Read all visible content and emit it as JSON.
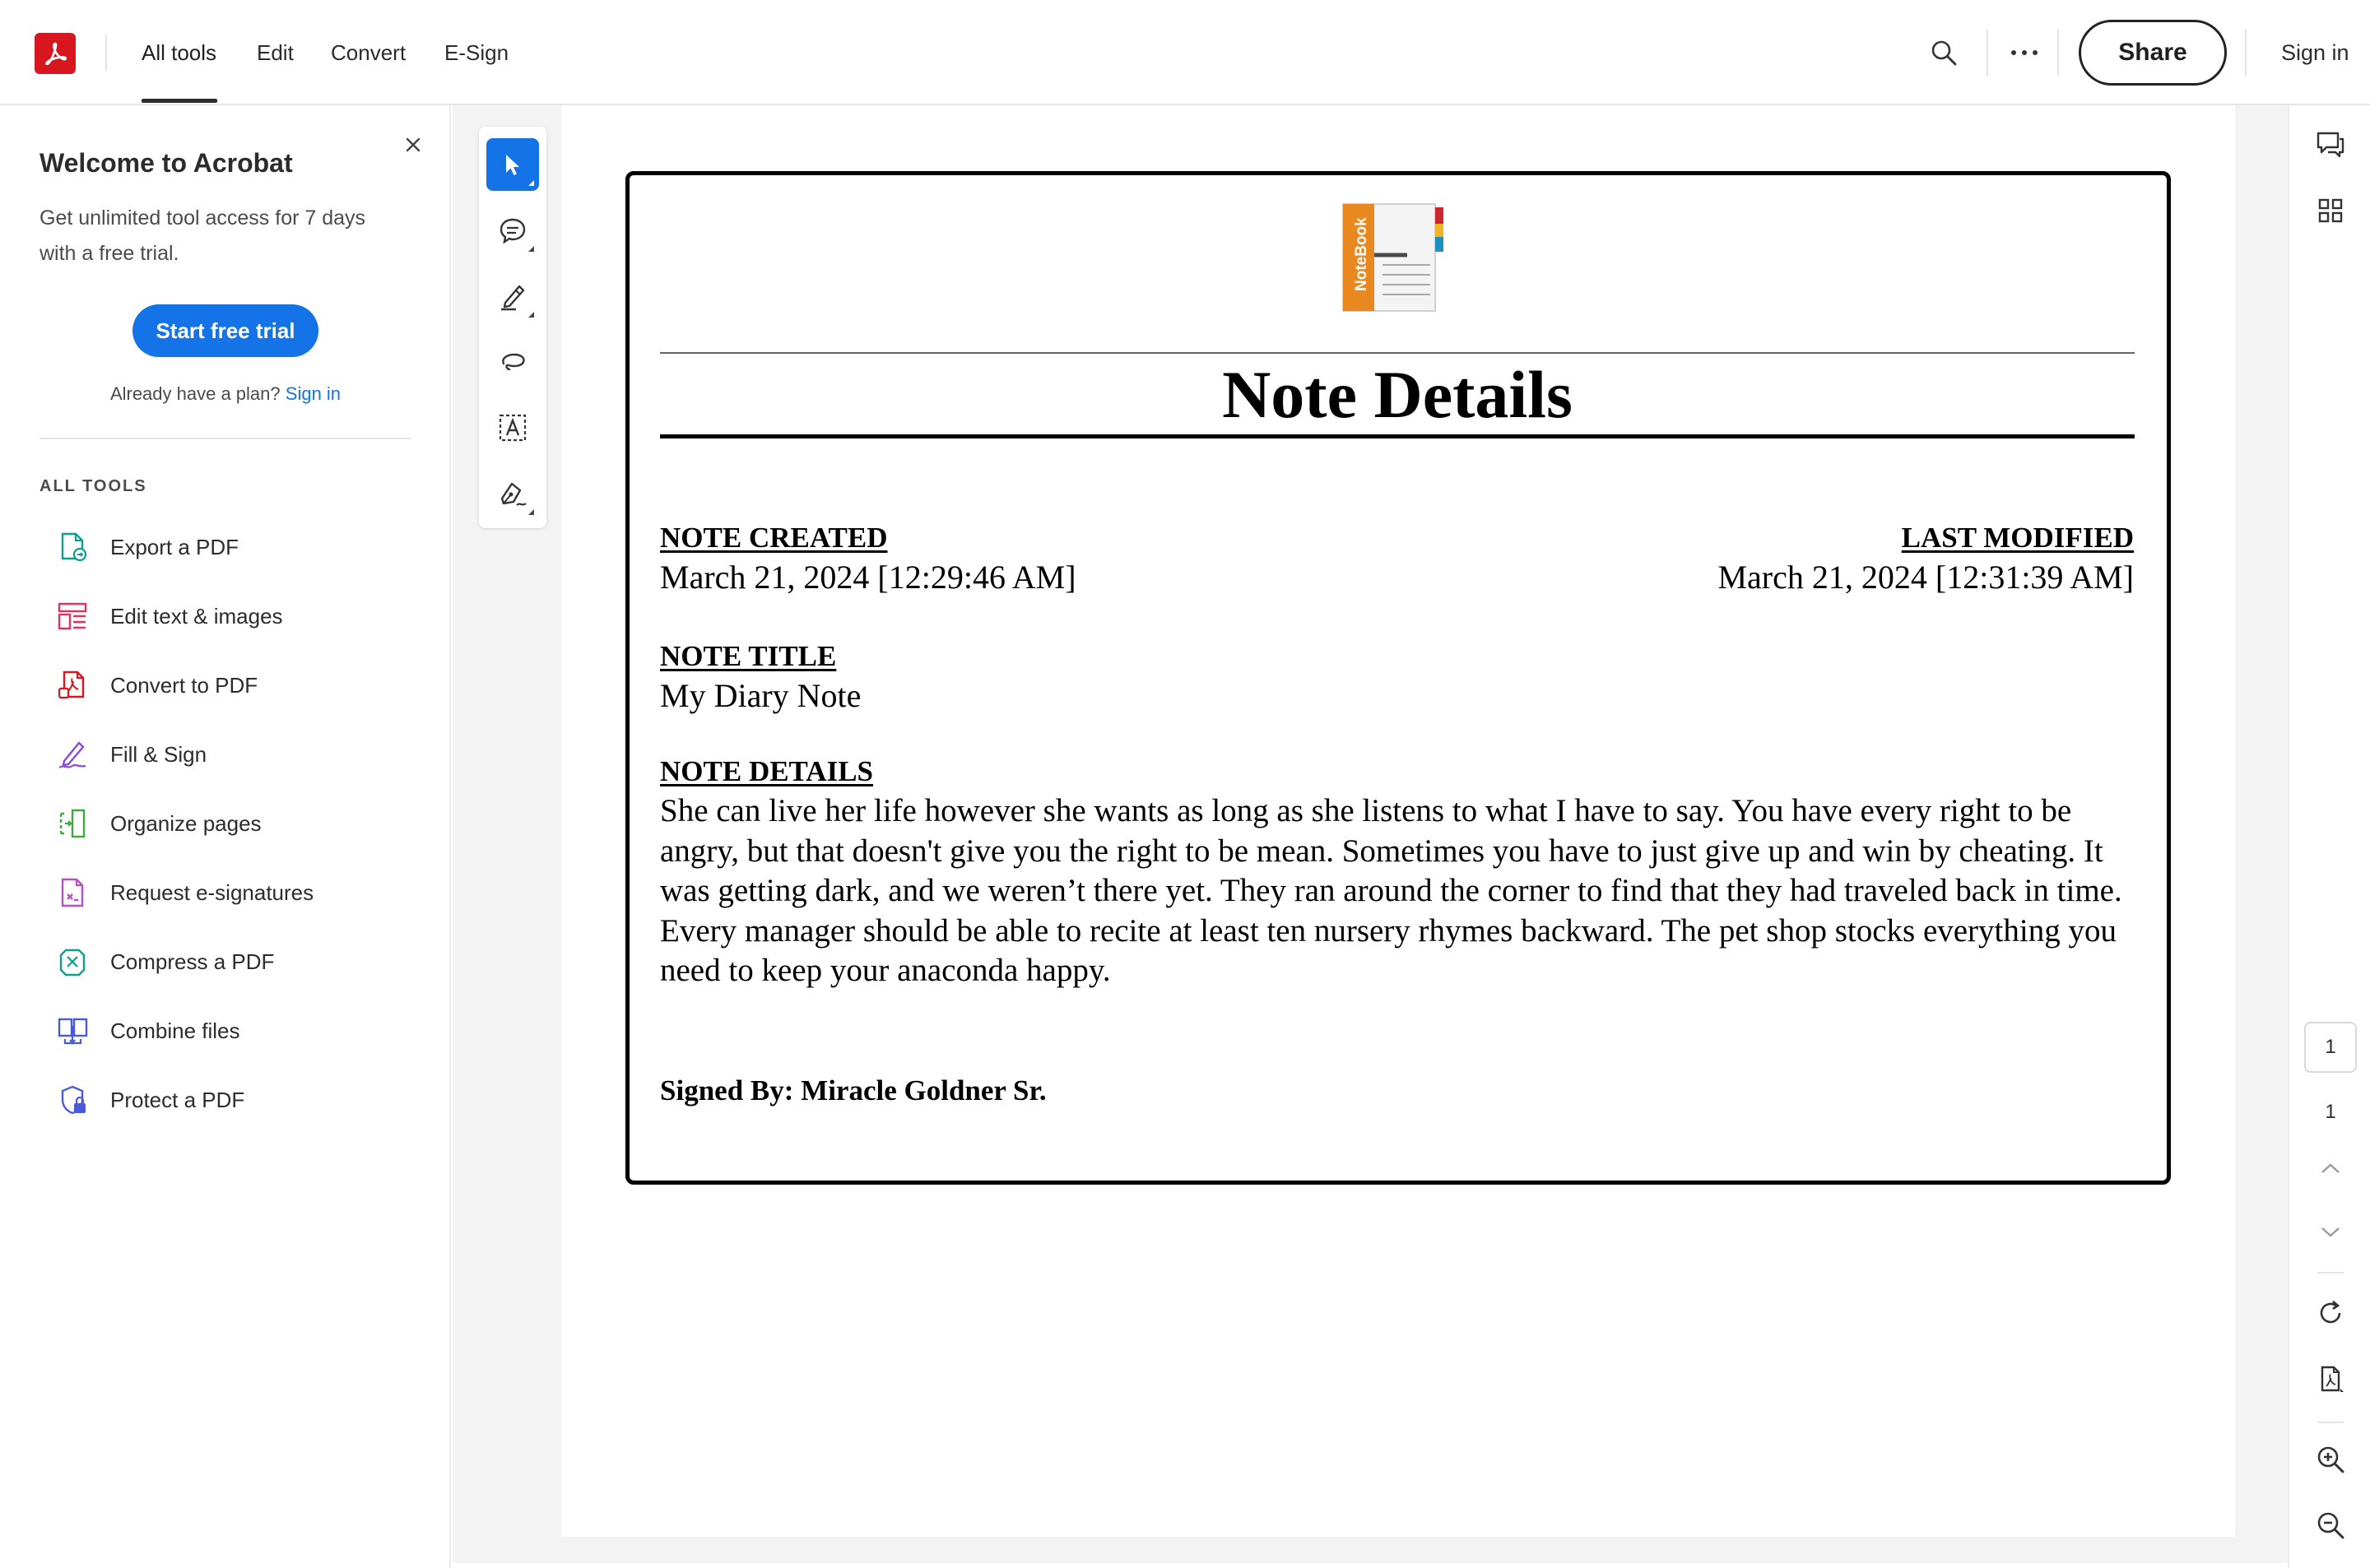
{
  "topbar": {
    "tabs": [
      {
        "label": "All tools",
        "active": true
      },
      {
        "label": "Edit",
        "active": false
      },
      {
        "label": "Convert",
        "active": false
      },
      {
        "label": "E-Sign",
        "active": false
      }
    ],
    "share_label": "Share",
    "signin_label": "Sign in",
    "icons": [
      "acrobat-logo-icon",
      "search-icon",
      "more-options-icon"
    ]
  },
  "left_panel": {
    "title": "Welcome to Acrobat",
    "text": "Get unlimited tool access for 7 days with a free trial.",
    "trial_button": "Start free trial",
    "plan_text": "Already have a plan?",
    "plan_link": "Sign in",
    "section_heading": "ALL TOOLS",
    "tools": [
      {
        "label": "Export a PDF",
        "icon": "export-pdf-icon",
        "color": "#0e9e8e"
      },
      {
        "label": "Edit text & images",
        "icon": "edit-text-icon",
        "color": "#e0345f"
      },
      {
        "label": "Convert to PDF",
        "icon": "convert-pdf-icon",
        "color": "#d7161f"
      },
      {
        "label": "Fill & Sign",
        "icon": "fill-sign-icon",
        "color": "#8a4bd6"
      },
      {
        "label": "Organize pages",
        "icon": "organize-pages-icon",
        "color": "#3fa83f"
      },
      {
        "label": "Request e-signatures",
        "icon": "request-esign-icon",
        "color": "#b64fc8"
      },
      {
        "label": "Compress a PDF",
        "icon": "compress-pdf-icon",
        "color": "#0e9e8e"
      },
      {
        "label": "Combine files",
        "icon": "combine-files-icon",
        "color": "#4a5ad8"
      },
      {
        "label": "Protect a PDF",
        "icon": "protect-pdf-icon",
        "color": "#4a5ad8"
      }
    ]
  },
  "toolbar": {
    "tools": [
      "select-pointer-icon",
      "add-comment-icon",
      "highlight-pen-icon",
      "freeform-draw-icon",
      "text-select-icon",
      "sign-pen-icon"
    ],
    "active_tool": "select-pointer-icon"
  },
  "document": {
    "logo_text": "NoteBook",
    "title": "Note Details",
    "created_label": "NOTE CREATED",
    "created_value": "March 21, 2024 [12:29:46 AM]",
    "modified_label": "LAST MODIFIED",
    "modified_value": "March 21, 2024 [12:31:39 AM]",
    "note_title_label": "NOTE TITLE",
    "note_title_value": "My Diary Note",
    "note_details_label": "NOTE DETAILS",
    "note_details_value": "She can live her life however she wants as long as she listens to what I have to say. You have every right to be angry, but that doesn't give you the right to be mean. Sometimes you have to just give up and win by cheating. It was getting dark, and we weren’t there yet. They ran around the corner to find that they had traveled back in time. Every manager should be able to recite at least ten nursery rhymes backward. The pet shop stocks everything you need to keep your anaconda happy.",
    "signed_by": "Signed By: Miracle Goldner Sr."
  },
  "right_rail": {
    "current_page": "1",
    "total_pages": "1",
    "icons": [
      "comments-icon",
      "thumbnails-grid-icon",
      "page-up-icon",
      "page-down-icon",
      "rotate-icon",
      "page-properties-icon",
      "zoom-in-icon",
      "zoom-out-icon"
    ]
  },
  "colors": {
    "accent": "#1473e6",
    "acrobat_red": "#d7161f",
    "notebook_orange": "#e8881f"
  }
}
